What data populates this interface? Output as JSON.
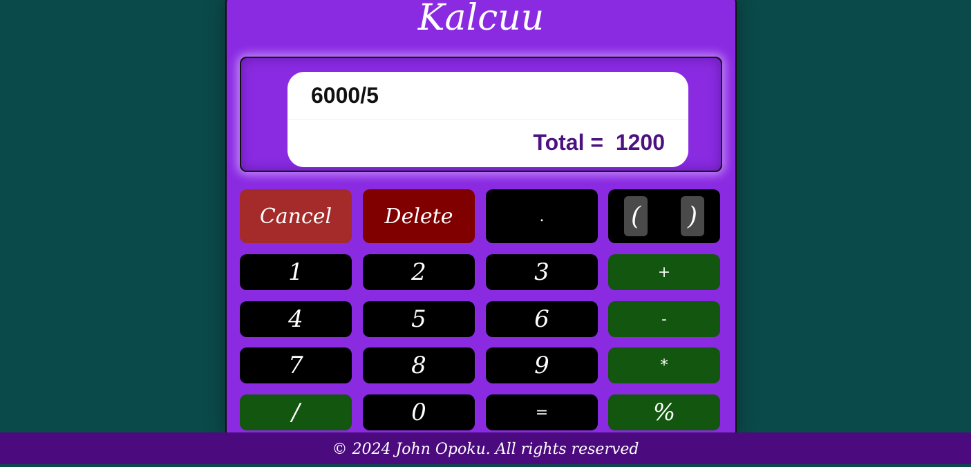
{
  "app": {
    "title": "Kalcuu"
  },
  "display": {
    "expression": "6000/5",
    "total_label": "Total =",
    "total_value": "1200"
  },
  "keys": {
    "cancel": "Cancel",
    "delete": "Delete",
    "dot": ".",
    "open_paren": "(",
    "close_paren": ")",
    "one": "1",
    "two": "2",
    "three": "3",
    "plus": "+",
    "four": "4",
    "five": "5",
    "six": "6",
    "minus": "-",
    "seven": "7",
    "eight": "8",
    "nine": "9",
    "multiply": "*",
    "divide": "/",
    "zero": "0",
    "equals": "=",
    "percent": "%"
  },
  "footer": {
    "text": "© 2024 John Opoku. All rights reserved"
  },
  "colors": {
    "background": "#0b4a4a",
    "calculator": "#8a2be2",
    "number_key": "#000000",
    "operator_key": "#12560f",
    "cancel_key": "#a52a2a",
    "delete_key": "#800000",
    "total_text": "#4b1280",
    "footer": "#4b0a7e"
  }
}
